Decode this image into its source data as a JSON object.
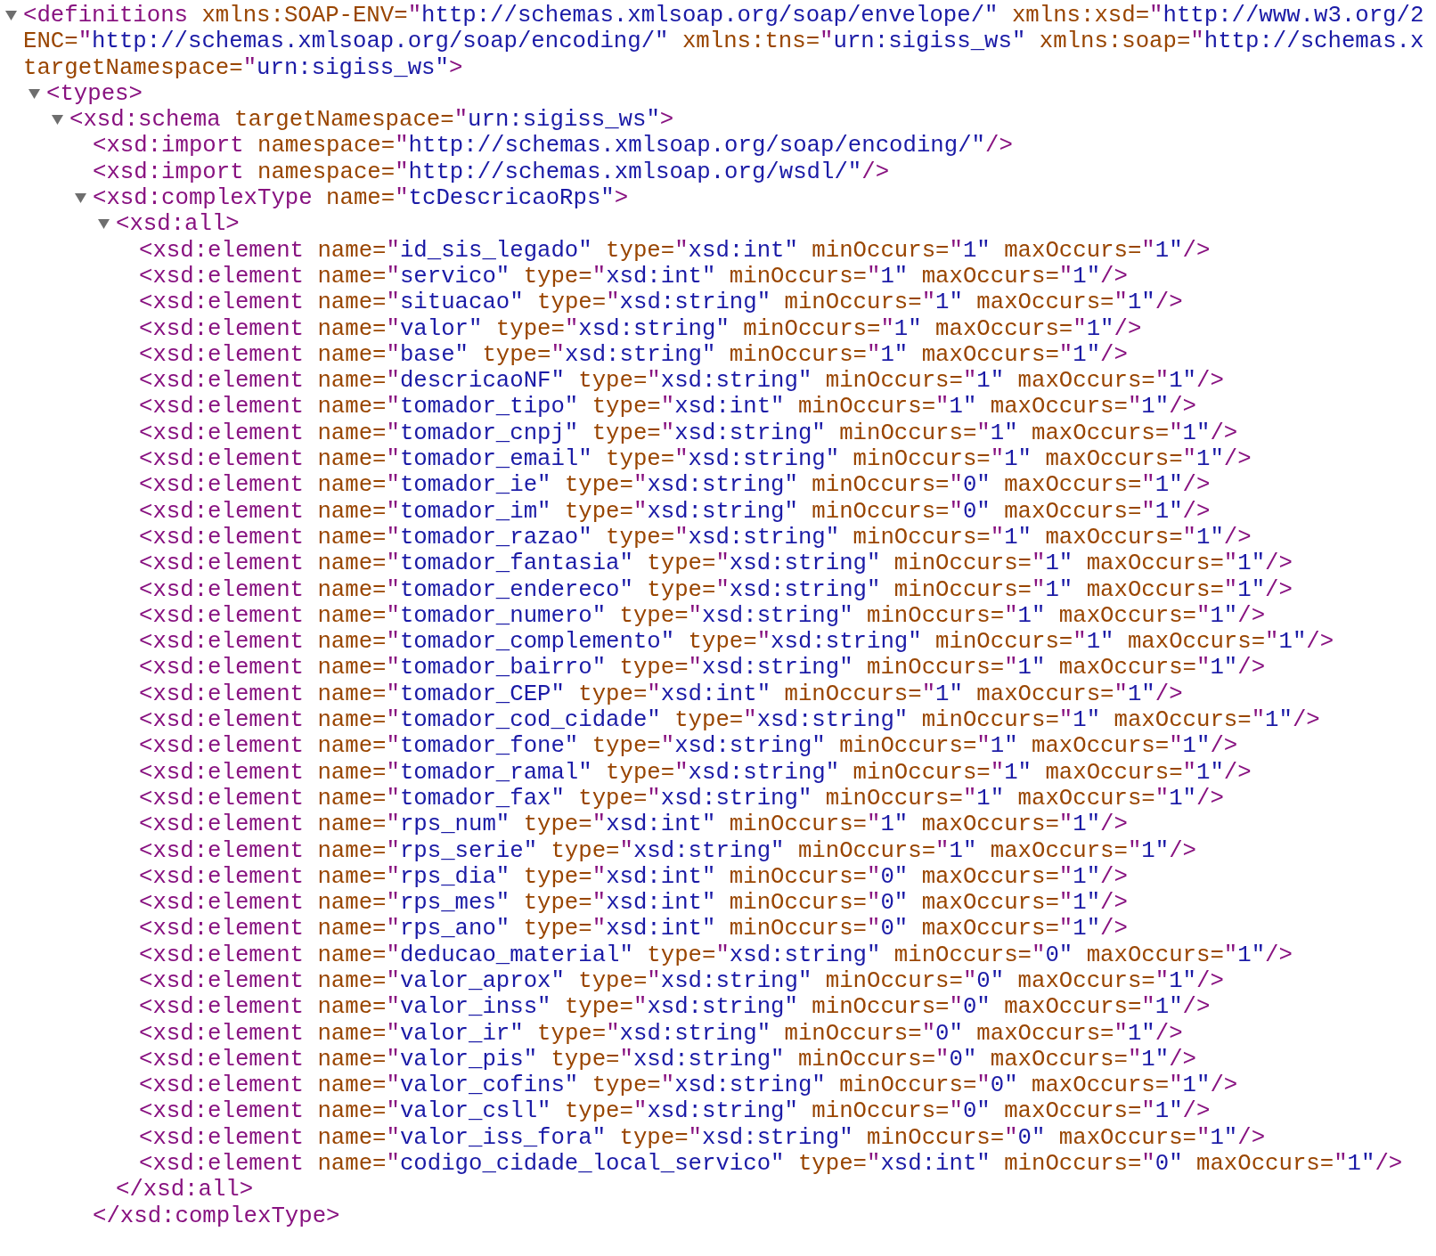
{
  "document": {
    "open": "<definitions",
    "expanded": true,
    "end": ">",
    "attribute_lines": [
      [
        {
          "name": "xmlns:SOAP-ENV=",
          "value": "\"http://schemas.xmlsoap.org/soap/envelope/\""
        },
        {
          "name": "xmlns:xsd=",
          "value": "\"http://www.w3.org/2"
        }
      ],
      [
        {
          "name": "ENC=",
          "value": "\"http://schemas.xmlsoap.org/soap/encoding/\""
        },
        {
          "name": "xmlns:tns=",
          "value": "\"urn:sigiss_ws\""
        },
        {
          "name": "xmlns:soap=",
          "value": "\"http://schemas.x"
        }
      ],
      [
        {
          "name": "targetNamespace=",
          "value": "\"urn:sigiss_ws\""
        }
      ]
    ],
    "children": [
      {
        "open": "<types",
        "expanded": true,
        "end": ">",
        "children": [
          {
            "open": "<xsd:schema",
            "expanded": true,
            "end": ">",
            "attributes": [
              {
                "name": "targetNamespace=",
                "value": "\"urn:sigiss_ws\""
              }
            ],
            "children": [
              {
                "open": "<xsd:import",
                "end": "/>",
                "attributes": [
                  {
                    "name": "namespace=",
                    "value": "\"http://schemas.xmlsoap.org/soap/encoding/\""
                  }
                ]
              },
              {
                "open": "<xsd:import",
                "end": "/>",
                "attributes": [
                  {
                    "name": "namespace=",
                    "value": "\"http://schemas.xmlsoap.org/wsdl/\""
                  }
                ]
              },
              {
                "open": "<xsd:complexType",
                "expanded": true,
                "end": ">",
                "close": "</xsd:complexType>",
                "attributes": [
                  {
                    "name": "name=",
                    "value": "\"tcDescricaoRps\""
                  }
                ],
                "children": [
                  {
                    "open": "<xsd:all",
                    "expanded": true,
                    "end": ">",
                    "close": "</xsd:all>",
                    "children": [
                      {
                        "open": "<xsd:element",
                        "end": "/>",
                        "attributes": [
                          {
                            "name": "name=",
                            "value": "\"id_sis_legado\""
                          },
                          {
                            "name": "type=",
                            "value": "\"xsd:int\""
                          },
                          {
                            "name": "minOccurs=",
                            "value": "\"1\""
                          },
                          {
                            "name": "maxOccurs=",
                            "value": "\"1\""
                          }
                        ]
                      },
                      {
                        "open": "<xsd:element",
                        "end": "/>",
                        "attributes": [
                          {
                            "name": "name=",
                            "value": "\"servico\""
                          },
                          {
                            "name": "type=",
                            "value": "\"xsd:int\""
                          },
                          {
                            "name": "minOccurs=",
                            "value": "\"1\""
                          },
                          {
                            "name": "maxOccurs=",
                            "value": "\"1\""
                          }
                        ]
                      },
                      {
                        "open": "<xsd:element",
                        "end": "/>",
                        "attributes": [
                          {
                            "name": "name=",
                            "value": "\"situacao\""
                          },
                          {
                            "name": "type=",
                            "value": "\"xsd:string\""
                          },
                          {
                            "name": "minOccurs=",
                            "value": "\"1\""
                          },
                          {
                            "name": "maxOccurs=",
                            "value": "\"1\""
                          }
                        ]
                      },
                      {
                        "open": "<xsd:element",
                        "end": "/>",
                        "attributes": [
                          {
                            "name": "name=",
                            "value": "\"valor\""
                          },
                          {
                            "name": "type=",
                            "value": "\"xsd:string\""
                          },
                          {
                            "name": "minOccurs=",
                            "value": "\"1\""
                          },
                          {
                            "name": "maxOccurs=",
                            "value": "\"1\""
                          }
                        ]
                      },
                      {
                        "open": "<xsd:element",
                        "end": "/>",
                        "attributes": [
                          {
                            "name": "name=",
                            "value": "\"base\""
                          },
                          {
                            "name": "type=",
                            "value": "\"xsd:string\""
                          },
                          {
                            "name": "minOccurs=",
                            "value": "\"1\""
                          },
                          {
                            "name": "maxOccurs=",
                            "value": "\"1\""
                          }
                        ]
                      },
                      {
                        "open": "<xsd:element",
                        "end": "/>",
                        "attributes": [
                          {
                            "name": "name=",
                            "value": "\"descricaoNF\""
                          },
                          {
                            "name": "type=",
                            "value": "\"xsd:string\""
                          },
                          {
                            "name": "minOccurs=",
                            "value": "\"1\""
                          },
                          {
                            "name": "maxOccurs=",
                            "value": "\"1\""
                          }
                        ]
                      },
                      {
                        "open": "<xsd:element",
                        "end": "/>",
                        "attributes": [
                          {
                            "name": "name=",
                            "value": "\"tomador_tipo\""
                          },
                          {
                            "name": "type=",
                            "value": "\"xsd:int\""
                          },
                          {
                            "name": "minOccurs=",
                            "value": "\"1\""
                          },
                          {
                            "name": "maxOccurs=",
                            "value": "\"1\""
                          }
                        ]
                      },
                      {
                        "open": "<xsd:element",
                        "end": "/>",
                        "attributes": [
                          {
                            "name": "name=",
                            "value": "\"tomador_cnpj\""
                          },
                          {
                            "name": "type=",
                            "value": "\"xsd:string\""
                          },
                          {
                            "name": "minOccurs=",
                            "value": "\"1\""
                          },
                          {
                            "name": "maxOccurs=",
                            "value": "\"1\""
                          }
                        ]
                      },
                      {
                        "open": "<xsd:element",
                        "end": "/>",
                        "attributes": [
                          {
                            "name": "name=",
                            "value": "\"tomador_email\""
                          },
                          {
                            "name": "type=",
                            "value": "\"xsd:string\""
                          },
                          {
                            "name": "minOccurs=",
                            "value": "\"1\""
                          },
                          {
                            "name": "maxOccurs=",
                            "value": "\"1\""
                          }
                        ]
                      },
                      {
                        "open": "<xsd:element",
                        "end": "/>",
                        "attributes": [
                          {
                            "name": "name=",
                            "value": "\"tomador_ie\""
                          },
                          {
                            "name": "type=",
                            "value": "\"xsd:string\""
                          },
                          {
                            "name": "minOccurs=",
                            "value": "\"0\""
                          },
                          {
                            "name": "maxOccurs=",
                            "value": "\"1\""
                          }
                        ]
                      },
                      {
                        "open": "<xsd:element",
                        "end": "/>",
                        "attributes": [
                          {
                            "name": "name=",
                            "value": "\"tomador_im\""
                          },
                          {
                            "name": "type=",
                            "value": "\"xsd:string\""
                          },
                          {
                            "name": "minOccurs=",
                            "value": "\"0\""
                          },
                          {
                            "name": "maxOccurs=",
                            "value": "\"1\""
                          }
                        ]
                      },
                      {
                        "open": "<xsd:element",
                        "end": "/>",
                        "attributes": [
                          {
                            "name": "name=",
                            "value": "\"tomador_razao\""
                          },
                          {
                            "name": "type=",
                            "value": "\"xsd:string\""
                          },
                          {
                            "name": "minOccurs=",
                            "value": "\"1\""
                          },
                          {
                            "name": "maxOccurs=",
                            "value": "\"1\""
                          }
                        ]
                      },
                      {
                        "open": "<xsd:element",
                        "end": "/>",
                        "attributes": [
                          {
                            "name": "name=",
                            "value": "\"tomador_fantasia\""
                          },
                          {
                            "name": "type=",
                            "value": "\"xsd:string\""
                          },
                          {
                            "name": "minOccurs=",
                            "value": "\"1\""
                          },
                          {
                            "name": "maxOccurs=",
                            "value": "\"1\""
                          }
                        ]
                      },
                      {
                        "open": "<xsd:element",
                        "end": "/>",
                        "attributes": [
                          {
                            "name": "name=",
                            "value": "\"tomador_endereco\""
                          },
                          {
                            "name": "type=",
                            "value": "\"xsd:string\""
                          },
                          {
                            "name": "minOccurs=",
                            "value": "\"1\""
                          },
                          {
                            "name": "maxOccurs=",
                            "value": "\"1\""
                          }
                        ]
                      },
                      {
                        "open": "<xsd:element",
                        "end": "/>",
                        "attributes": [
                          {
                            "name": "name=",
                            "value": "\"tomador_numero\""
                          },
                          {
                            "name": "type=",
                            "value": "\"xsd:string\""
                          },
                          {
                            "name": "minOccurs=",
                            "value": "\"1\""
                          },
                          {
                            "name": "maxOccurs=",
                            "value": "\"1\""
                          }
                        ]
                      },
                      {
                        "open": "<xsd:element",
                        "end": "/>",
                        "attributes": [
                          {
                            "name": "name=",
                            "value": "\"tomador_complemento\""
                          },
                          {
                            "name": "type=",
                            "value": "\"xsd:string\""
                          },
                          {
                            "name": "minOccurs=",
                            "value": "\"1\""
                          },
                          {
                            "name": "maxOccurs=",
                            "value": "\"1\""
                          }
                        ]
                      },
                      {
                        "open": "<xsd:element",
                        "end": "/>",
                        "attributes": [
                          {
                            "name": "name=",
                            "value": "\"tomador_bairro\""
                          },
                          {
                            "name": "type=",
                            "value": "\"xsd:string\""
                          },
                          {
                            "name": "minOccurs=",
                            "value": "\"1\""
                          },
                          {
                            "name": "maxOccurs=",
                            "value": "\"1\""
                          }
                        ]
                      },
                      {
                        "open": "<xsd:element",
                        "end": "/>",
                        "attributes": [
                          {
                            "name": "name=",
                            "value": "\"tomador_CEP\""
                          },
                          {
                            "name": "type=",
                            "value": "\"xsd:int\""
                          },
                          {
                            "name": "minOccurs=",
                            "value": "\"1\""
                          },
                          {
                            "name": "maxOccurs=",
                            "value": "\"1\""
                          }
                        ]
                      },
                      {
                        "open": "<xsd:element",
                        "end": "/>",
                        "attributes": [
                          {
                            "name": "name=",
                            "value": "\"tomador_cod_cidade\""
                          },
                          {
                            "name": "type=",
                            "value": "\"xsd:string\""
                          },
                          {
                            "name": "minOccurs=",
                            "value": "\"1\""
                          },
                          {
                            "name": "maxOccurs=",
                            "value": "\"1\""
                          }
                        ]
                      },
                      {
                        "open": "<xsd:element",
                        "end": "/>",
                        "attributes": [
                          {
                            "name": "name=",
                            "value": "\"tomador_fone\""
                          },
                          {
                            "name": "type=",
                            "value": "\"xsd:string\""
                          },
                          {
                            "name": "minOccurs=",
                            "value": "\"1\""
                          },
                          {
                            "name": "maxOccurs=",
                            "value": "\"1\""
                          }
                        ]
                      },
                      {
                        "open": "<xsd:element",
                        "end": "/>",
                        "attributes": [
                          {
                            "name": "name=",
                            "value": "\"tomador_ramal\""
                          },
                          {
                            "name": "type=",
                            "value": "\"xsd:string\""
                          },
                          {
                            "name": "minOccurs=",
                            "value": "\"1\""
                          },
                          {
                            "name": "maxOccurs=",
                            "value": "\"1\""
                          }
                        ]
                      },
                      {
                        "open": "<xsd:element",
                        "end": "/>",
                        "attributes": [
                          {
                            "name": "name=",
                            "value": "\"tomador_fax\""
                          },
                          {
                            "name": "type=",
                            "value": "\"xsd:string\""
                          },
                          {
                            "name": "minOccurs=",
                            "value": "\"1\""
                          },
                          {
                            "name": "maxOccurs=",
                            "value": "\"1\""
                          }
                        ]
                      },
                      {
                        "open": "<xsd:element",
                        "end": "/>",
                        "attributes": [
                          {
                            "name": "name=",
                            "value": "\"rps_num\""
                          },
                          {
                            "name": "type=",
                            "value": "\"xsd:int\""
                          },
                          {
                            "name": "minOccurs=",
                            "value": "\"1\""
                          },
                          {
                            "name": "maxOccurs=",
                            "value": "\"1\""
                          }
                        ]
                      },
                      {
                        "open": "<xsd:element",
                        "end": "/>",
                        "attributes": [
                          {
                            "name": "name=",
                            "value": "\"rps_serie\""
                          },
                          {
                            "name": "type=",
                            "value": "\"xsd:string\""
                          },
                          {
                            "name": "minOccurs=",
                            "value": "\"1\""
                          },
                          {
                            "name": "maxOccurs=",
                            "value": "\"1\""
                          }
                        ]
                      },
                      {
                        "open": "<xsd:element",
                        "end": "/>",
                        "attributes": [
                          {
                            "name": "name=",
                            "value": "\"rps_dia\""
                          },
                          {
                            "name": "type=",
                            "value": "\"xsd:int\""
                          },
                          {
                            "name": "minOccurs=",
                            "value": "\"0\""
                          },
                          {
                            "name": "maxOccurs=",
                            "value": "\"1\""
                          }
                        ]
                      },
                      {
                        "open": "<xsd:element",
                        "end": "/>",
                        "attributes": [
                          {
                            "name": "name=",
                            "value": "\"rps_mes\""
                          },
                          {
                            "name": "type=",
                            "value": "\"xsd:int\""
                          },
                          {
                            "name": "minOccurs=",
                            "value": "\"0\""
                          },
                          {
                            "name": "maxOccurs=",
                            "value": "\"1\""
                          }
                        ]
                      },
                      {
                        "open": "<xsd:element",
                        "end": "/>",
                        "attributes": [
                          {
                            "name": "name=",
                            "value": "\"rps_ano\""
                          },
                          {
                            "name": "type=",
                            "value": "\"xsd:int\""
                          },
                          {
                            "name": "minOccurs=",
                            "value": "\"0\""
                          },
                          {
                            "name": "maxOccurs=",
                            "value": "\"1\""
                          }
                        ]
                      },
                      {
                        "open": "<xsd:element",
                        "end": "/>",
                        "attributes": [
                          {
                            "name": "name=",
                            "value": "\"deducao_material\""
                          },
                          {
                            "name": "type=",
                            "value": "\"xsd:string\""
                          },
                          {
                            "name": "minOccurs=",
                            "value": "\"0\""
                          },
                          {
                            "name": "maxOccurs=",
                            "value": "\"1\""
                          }
                        ]
                      },
                      {
                        "open": "<xsd:element",
                        "end": "/>",
                        "attributes": [
                          {
                            "name": "name=",
                            "value": "\"valor_aprox\""
                          },
                          {
                            "name": "type=",
                            "value": "\"xsd:string\""
                          },
                          {
                            "name": "minOccurs=",
                            "value": "\"0\""
                          },
                          {
                            "name": "maxOccurs=",
                            "value": "\"1\""
                          }
                        ]
                      },
                      {
                        "open": "<xsd:element",
                        "end": "/>",
                        "attributes": [
                          {
                            "name": "name=",
                            "value": "\"valor_inss\""
                          },
                          {
                            "name": "type=",
                            "value": "\"xsd:string\""
                          },
                          {
                            "name": "minOccurs=",
                            "value": "\"0\""
                          },
                          {
                            "name": "maxOccurs=",
                            "value": "\"1\""
                          }
                        ]
                      },
                      {
                        "open": "<xsd:element",
                        "end": "/>",
                        "attributes": [
                          {
                            "name": "name=",
                            "value": "\"valor_ir\""
                          },
                          {
                            "name": "type=",
                            "value": "\"xsd:string\""
                          },
                          {
                            "name": "minOccurs=",
                            "value": "\"0\""
                          },
                          {
                            "name": "maxOccurs=",
                            "value": "\"1\""
                          }
                        ]
                      },
                      {
                        "open": "<xsd:element",
                        "end": "/>",
                        "attributes": [
                          {
                            "name": "name=",
                            "value": "\"valor_pis\""
                          },
                          {
                            "name": "type=",
                            "value": "\"xsd:string\""
                          },
                          {
                            "name": "minOccurs=",
                            "value": "\"0\""
                          },
                          {
                            "name": "maxOccurs=",
                            "value": "\"1\""
                          }
                        ]
                      },
                      {
                        "open": "<xsd:element",
                        "end": "/>",
                        "attributes": [
                          {
                            "name": "name=",
                            "value": "\"valor_cofins\""
                          },
                          {
                            "name": "type=",
                            "value": "\"xsd:string\""
                          },
                          {
                            "name": "minOccurs=",
                            "value": "\"0\""
                          },
                          {
                            "name": "maxOccurs=",
                            "value": "\"1\""
                          }
                        ]
                      },
                      {
                        "open": "<xsd:element",
                        "end": "/>",
                        "attributes": [
                          {
                            "name": "name=",
                            "value": "\"valor_csll\""
                          },
                          {
                            "name": "type=",
                            "value": "\"xsd:string\""
                          },
                          {
                            "name": "minOccurs=",
                            "value": "\"0\""
                          },
                          {
                            "name": "maxOccurs=",
                            "value": "\"1\""
                          }
                        ]
                      },
                      {
                        "open": "<xsd:element",
                        "end": "/>",
                        "attributes": [
                          {
                            "name": "name=",
                            "value": "\"valor_iss_fora\""
                          },
                          {
                            "name": "type=",
                            "value": "\"xsd:string\""
                          },
                          {
                            "name": "minOccurs=",
                            "value": "\"0\""
                          },
                          {
                            "name": "maxOccurs=",
                            "value": "\"1\""
                          }
                        ]
                      },
                      {
                        "open": "<xsd:element",
                        "end": "/>",
                        "attributes": [
                          {
                            "name": "name=",
                            "value": "\"codigo_cidade_local_servico\""
                          },
                          {
                            "name": "type=",
                            "value": "\"xsd:int\""
                          },
                          {
                            "name": "minOccurs=",
                            "value": "\"0\""
                          },
                          {
                            "name": "maxOccurs=",
                            "value": "\"1\""
                          }
                        ]
                      }
                    ]
                  }
                ]
              }
            ]
          }
        ]
      }
    ]
  }
}
